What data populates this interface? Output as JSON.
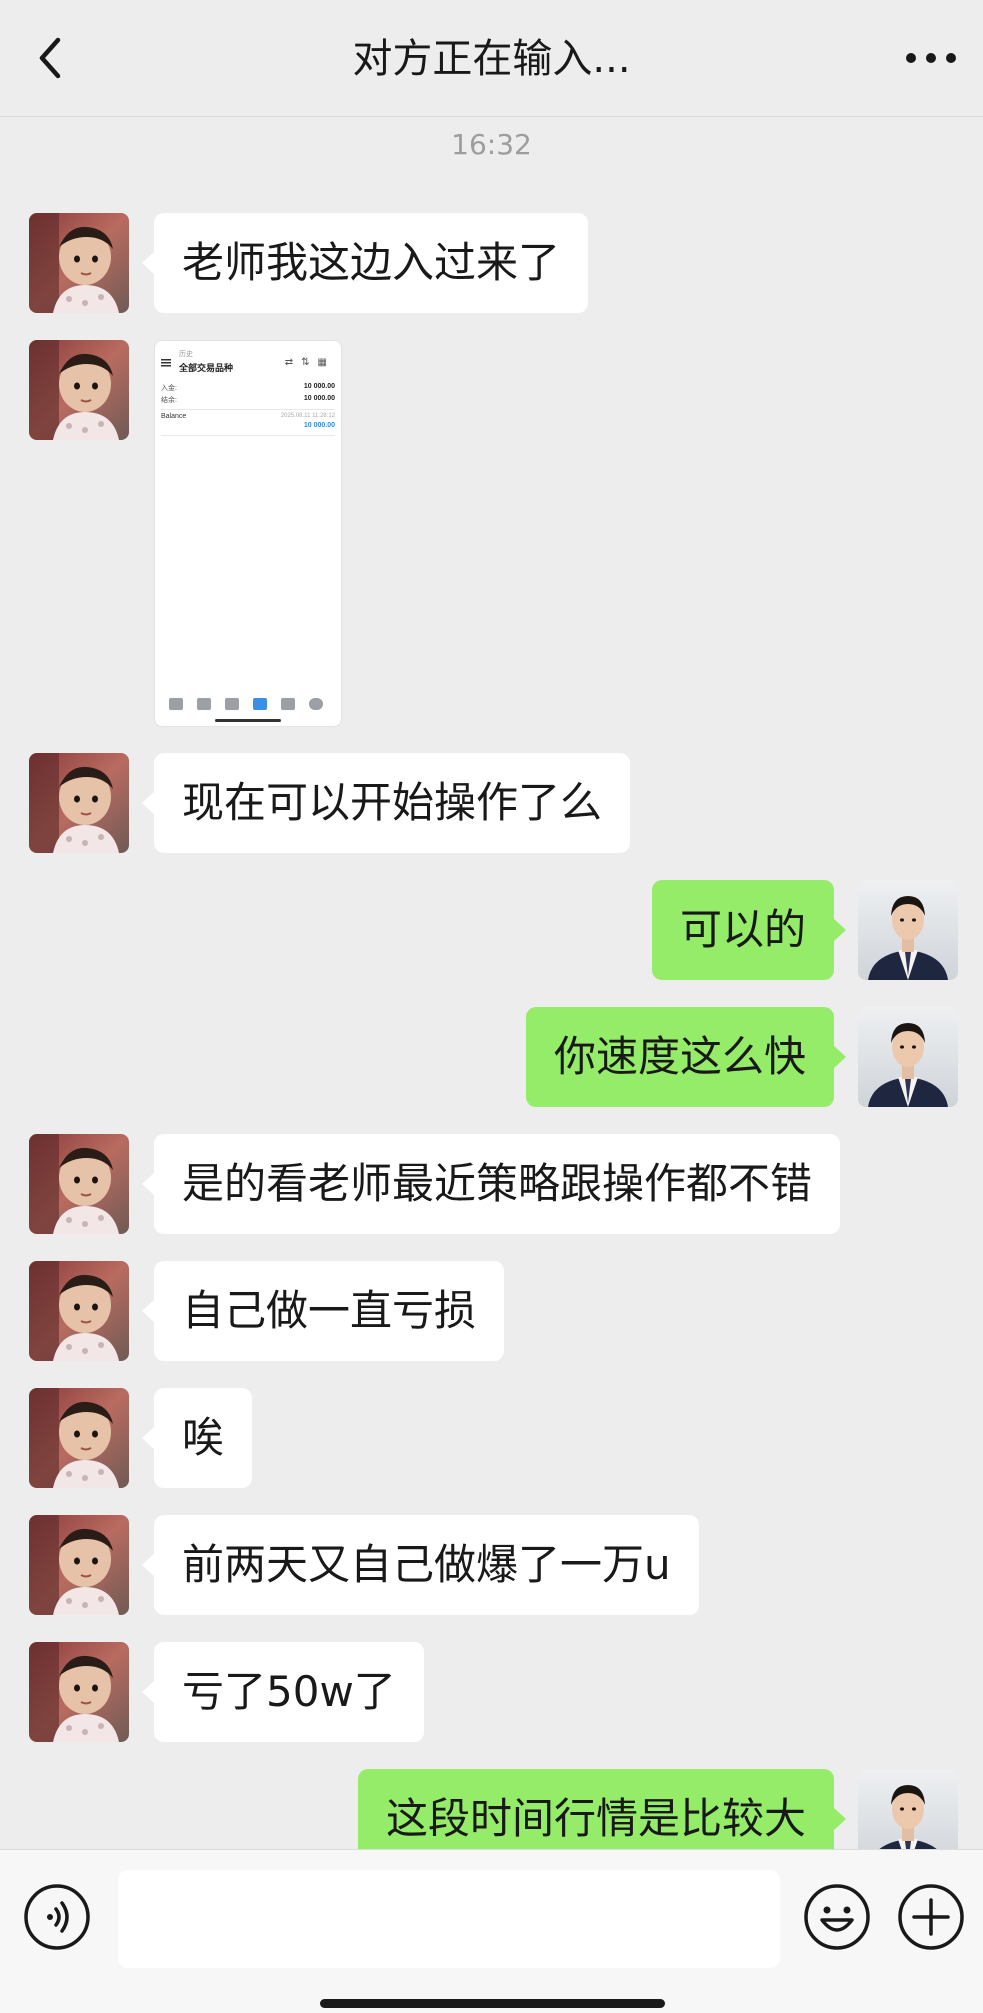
{
  "header": {
    "title": "对方正在输入..."
  },
  "timestamp": "16:32",
  "messages": [
    {
      "side": "in",
      "type": "text",
      "text": "老师我这边入过来了"
    },
    {
      "side": "in",
      "type": "image",
      "screenshot": {
        "subtitle": "历史",
        "title": "全部交易品种",
        "rows": [
          {
            "label": "入金:",
            "value": "10 000.00"
          },
          {
            "label": "结余:",
            "value": "10 000.00"
          }
        ],
        "entry": {
          "name": "Balance",
          "date": "2025.08.11 11:28:12",
          "amount": "10 000.00"
        }
      }
    },
    {
      "side": "in",
      "type": "text",
      "text": "现在可以开始操作了么"
    },
    {
      "side": "out",
      "type": "text",
      "text": "可以的"
    },
    {
      "side": "out",
      "type": "text",
      "text": "你速度这么快"
    },
    {
      "side": "in",
      "type": "text",
      "text": "是的看老师最近策略跟操作都不错"
    },
    {
      "side": "in",
      "type": "text",
      "text": "自己做一直亏损"
    },
    {
      "side": "in",
      "type": "text",
      "text": "唉"
    },
    {
      "side": "in",
      "type": "text",
      "text": "前两天又自己做爆了一万u"
    },
    {
      "side": "in",
      "type": "text",
      "text": "亏了50w了"
    },
    {
      "side": "out",
      "type": "text",
      "text": "这段时间行情是比较大"
    }
  ],
  "composer": {
    "input_value": "",
    "input_placeholder": ""
  },
  "colors": {
    "background": "#ededed",
    "incoming_bubble": "#ffffff",
    "outgoing_bubble": "#95ec69",
    "text": "#191919"
  },
  "icons": {
    "back": "chevron-left-icon",
    "more": "more-dots-icon",
    "voice": "voice-icon",
    "emoji": "emoji-icon",
    "plus": "plus-icon"
  }
}
